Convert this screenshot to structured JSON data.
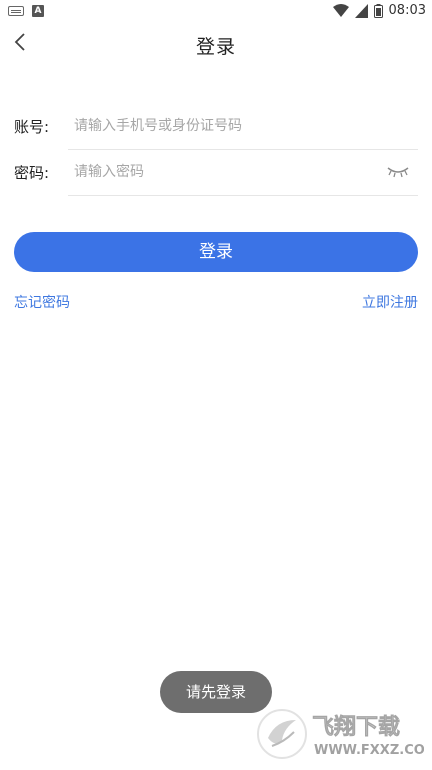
{
  "status_bar": {
    "time": "08:03",
    "icons": [
      "keyboard-icon",
      "a-notification-icon",
      "wifi-icon",
      "signal-icon",
      "battery-icon"
    ]
  },
  "header": {
    "title": "登录",
    "back_icon": "chevron-left-icon"
  },
  "form": {
    "account": {
      "label": "账号:",
      "placeholder": "请输入手机号或身份证号码",
      "value": ""
    },
    "password": {
      "label": "密码:",
      "placeholder": "请输入密码",
      "value": "",
      "toggle_icon": "eye-closed-icon"
    }
  },
  "actions": {
    "login_label": "登录",
    "forgot_label": "忘记密码",
    "register_label": "立即注册"
  },
  "toast": {
    "text": "请先登录"
  },
  "watermark": {
    "brand": "飞翔下载",
    "domain": "WWW.FXXZ.COM"
  },
  "colors": {
    "accent": "#3b73e6",
    "link": "#3f78e0",
    "toast_bg": "#6e6e6e"
  }
}
